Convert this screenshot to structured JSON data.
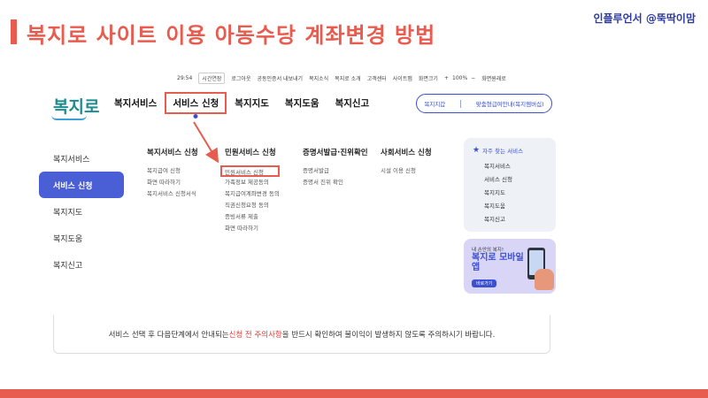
{
  "slide": {
    "title": "복지로 사이트 이용 아동수당 계좌변경 방법",
    "brand": "인플루언서 @뚝딱이맘",
    "accent_color": "#e85b4f"
  },
  "utility_bar": {
    "timer": "29:54",
    "extend": "시간연장",
    "links": [
      "로그아웃",
      "공동인증서 내보내기",
      "복지소식",
      "복지로 소개",
      "고객센터",
      "사이트맵",
      "화면크기"
    ],
    "zoom_plus": "+",
    "zoom_value": "100%",
    "zoom_minus": "−",
    "reset": "화면원래로"
  },
  "header": {
    "logo": "복지로",
    "gnb": [
      "복지서비스",
      "서비스 신청",
      "복지지도",
      "복지도움",
      "복지신고"
    ],
    "pill_left": "복지지갑",
    "pill_right": "맞춤형급여안내(복지멤버십)"
  },
  "sidebar": {
    "items": [
      {
        "label": "복지서비스"
      },
      {
        "label": "서비스 신청"
      },
      {
        "label": "복지지도"
      },
      {
        "label": "복지도움"
      },
      {
        "label": "복지신고"
      }
    ]
  },
  "menu": {
    "col1": {
      "title": "복지서비스 신청",
      "items": [
        "복지급여 신청",
        "화면 따라하기",
        "복지서비스 신청서식"
      ]
    },
    "col2": {
      "title": "민원서비스 신청",
      "items": [
        "민원서비스 신청",
        "가족정보 제공동의",
        "복지급여계좌변경 동의",
        "직권신청요청 동의",
        "증빙서류 제출",
        "화면 따라하기"
      ]
    },
    "col3": {
      "title": "증명서발급·진위확인",
      "items": [
        "증명서발급",
        "증명서 진위 확인"
      ]
    },
    "col4": {
      "title": "사회서비스 신청",
      "items": [
        "시설 이용 신청"
      ]
    }
  },
  "favorites": {
    "title": "자주 찾는 서비스",
    "items": [
      "복지서비스",
      "서비스 신청",
      "복지지도",
      "복지도움",
      "복지신고"
    ]
  },
  "mobile_banner": {
    "line1": "내 손안의 복지!",
    "line2": "복지로 모바일앱",
    "button": "바로가기"
  },
  "notice": {
    "before": "서비스 선택 후 다음단계에서 안내되는 ",
    "highlight": "신청 전 주의사항",
    "after": "을 반드시 확인하여 불이익이 발생하지 않도록 주의하시기 바랍니다."
  }
}
